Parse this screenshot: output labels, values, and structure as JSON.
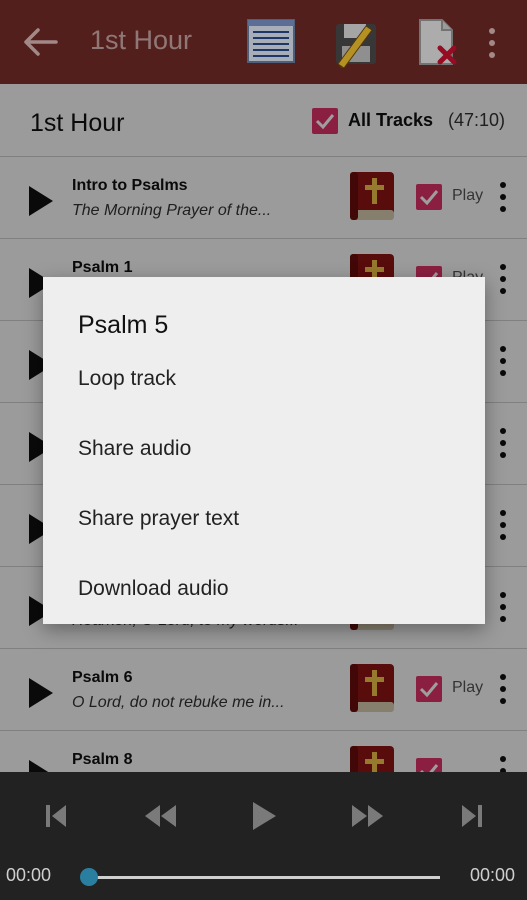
{
  "appbar": {
    "title": "1st Hour"
  },
  "header": {
    "title": "1st Hour",
    "all_tracks_label": "All Tracks",
    "total_time": "(47:10)"
  },
  "tracks": [
    {
      "title": "Intro to Psalms",
      "subtitle": "The Morning Prayer of the...",
      "play_label": "Play"
    },
    {
      "title": "Psalm 1",
      "subtitle": "",
      "play_label": "Play"
    },
    {
      "title": "",
      "subtitle": "",
      "play_label": ""
    },
    {
      "title": "",
      "subtitle": "",
      "play_label": ""
    },
    {
      "title": "",
      "subtitle": "",
      "play_label": ""
    },
    {
      "title": "",
      "subtitle": "Hearken, O Lord, to my words...",
      "play_label": ""
    },
    {
      "title": "Psalm 6",
      "subtitle": "O Lord, do not rebuke me in...",
      "play_label": "Play"
    },
    {
      "title": "Psalm 8",
      "subtitle": "",
      "play_label": ""
    }
  ],
  "dialog": {
    "title": "Psalm 5",
    "items": [
      "Loop track",
      "Share audio",
      "Share prayer text",
      "Download audio"
    ]
  },
  "player": {
    "current_time": "00:00",
    "total_time": "00:00",
    "progress": 0
  },
  "colors": {
    "appbar": "#6f2a27",
    "accent": "#e0336a",
    "player_bg": "#222222",
    "seek_thumb": "#2a7fa0"
  },
  "icons": [
    "back-arrow-icon",
    "list-icon",
    "edit-disk-icon",
    "delete-file-icon",
    "overflow-menu-icon",
    "play-icon",
    "bible-icon",
    "checkbox-icon",
    "skip-previous-icon",
    "rewind-icon",
    "play-icon",
    "fast-forward-icon",
    "skip-next-icon"
  ]
}
